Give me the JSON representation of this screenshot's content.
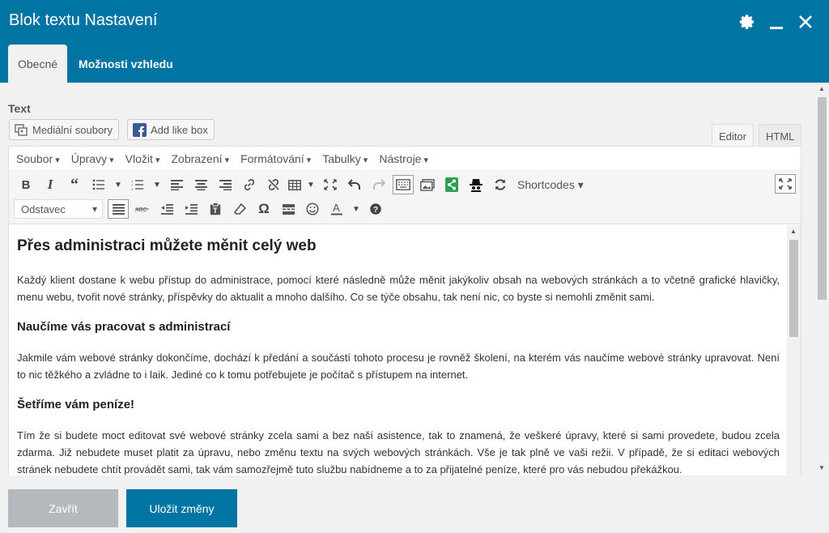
{
  "dialog": {
    "title": "Blok textu Nastavení",
    "tabs": [
      "Obecné",
      "Možnosti vzhledu"
    ]
  },
  "field": {
    "label": "Text"
  },
  "media_buttons": {
    "media": "Mediální soubory",
    "like": "Add like box"
  },
  "editor_tabs": {
    "visual": "Editor",
    "html": "HTML"
  },
  "menubar": [
    "Soubor",
    "Úpravy",
    "Vložit",
    "Zobrazení",
    "Formátování",
    "Tabulky",
    "Nástroje"
  ],
  "toolbar": {
    "shortcodes": "Shortcodes",
    "format_select": "Odstavec"
  },
  "content": {
    "heading1": "Přes administraci můžete měnit celý web",
    "p1": "Každý klient dostane k webu přístup do administrace, pomocí které následně může měnit jakýkoliv obsah na webových stránkách a to včetně grafické hlavičky, menu webu, tvořit nové stránky, příspěvky do aktualit a mnoho dalšího. Co se týče obsahu, tak není nic, co byste si nemohli změnit sami.",
    "heading2": "Naučíme vás pracovat s administrací",
    "p2": "Jakmile vám webové stránky dokončíme, dochází k předání a součástí tohoto procesu je rovněž školení, na kterém vás naučíme webové stránky upravovat. Není to nic těžkého a zvládne to i laik. Jediné co k tomu potřebujete je počítač s přístupem na internet.",
    "heading3": "Šetříme vám peníze!",
    "p3": "Tím že si budete moct editovat své webové stránky zcela sami a bez naší asistence, tak to znamená, že veškeré úpravy, které si sami provedete, budou zcela zdarma. Již nebudete muset platit za úpravu, nebo změnu textu na svých webových stránkách. Vše je tak plně ve vaši režii. V případě, že si editaci webových stránek nebudete chtít provádět sami, tak vám samozřejmě tuto službu nabídneme a to za přijatelné peníze, které pro vás nebudou překážkou."
  },
  "footer": {
    "close": "Zavřít",
    "save": "Uložit změny"
  },
  "colors": {
    "header": "#0074a2",
    "button_primary": "#0074a2",
    "button_disabled": "#b4b9be"
  }
}
